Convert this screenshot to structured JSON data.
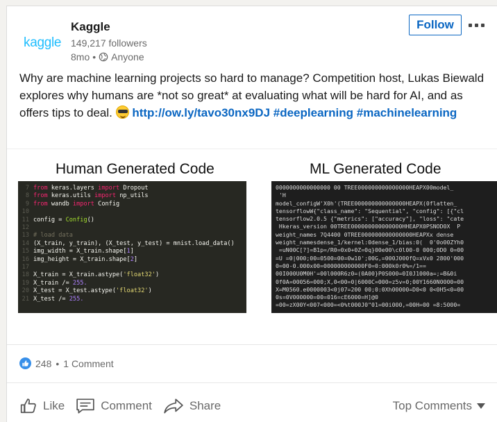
{
  "actor": {
    "logo": "kaggle",
    "name": "Kaggle",
    "followers": "149,217 followers",
    "time": "8mo",
    "separator": "•",
    "visibility": "Anyone",
    "follow_label": "Follow"
  },
  "post": {
    "text": "Why are machine learning projects so hard to manage? Competition host, Lukas Biewald explores why humans are *not so great* at evaluating what will be hard for AI, and as offers tips to deal.",
    "link": "http://ow.ly/tavo30nx9DJ",
    "hashtag1": "#deeplearning",
    "hashtag2": "#machinelearning"
  },
  "image": {
    "left_title": "Human Generated Code",
    "right_title": "ML Generated Code"
  },
  "social": {
    "likes": "248",
    "dot": "•",
    "comments": "1 Comment"
  },
  "actions": {
    "like": "Like",
    "comment": "Comment",
    "share": "Share",
    "sort": "Top Comments"
  },
  "colors": {
    "brand_blue": "#0a66c2",
    "kaggle_blue": "#20beff",
    "like_blue": "#378fe9"
  }
}
